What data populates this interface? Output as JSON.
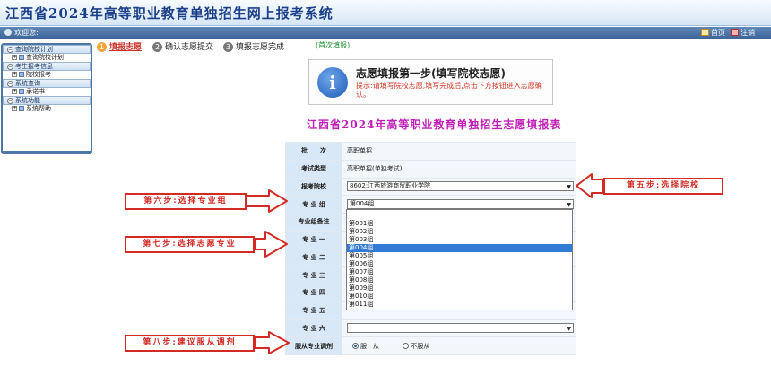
{
  "header": {
    "title": "江西省2024年高等职业教育单独招生网上报考系统"
  },
  "topbar": {
    "welcome": "欢迎您:",
    "home": "首页",
    "logout": "注销"
  },
  "sidebar": {
    "groups": [
      {
        "label": "查询院校计划",
        "items": [
          {
            "label": "查询院校计划"
          }
        ]
      },
      {
        "label": "考生报考信息",
        "items": [
          {
            "label": "院校报考"
          }
        ]
      },
      {
        "label": "系统查询",
        "items": [
          {
            "label": "承诺书"
          }
        ]
      },
      {
        "label": "系统功能",
        "items": [
          {
            "label": "系统帮助"
          }
        ]
      }
    ]
  },
  "steps": [
    {
      "num": "1",
      "label": "填报志愿"
    },
    {
      "num": "2",
      "label": "确认志愿提交"
    },
    {
      "num": "3",
      "label": "填报志愿完成"
    }
  ],
  "first_tag": "(首次填报)",
  "info": {
    "title": "志愿填报第一步(填写院校志愿)",
    "text": "提示:请填写院校志愿,填写完成后,点击下方按钮进入志愿确认。"
  },
  "form": {
    "title": "江西省2024年高等职业教育单独招生志愿填报表",
    "rows": {
      "batch": {
        "label": "批　　次",
        "value": "高职单招"
      },
      "exam_type": {
        "label": "考试类型",
        "value": "高职单招(单独考试)"
      },
      "school": {
        "label": "报考院校",
        "value": "8602:江西旅游商贸职业学院"
      },
      "group": {
        "label": "专 业 组",
        "value": "第004组"
      },
      "group_note": {
        "label": "专业组备注"
      },
      "major1": {
        "label": "专 业 一"
      },
      "major2": {
        "label": "专 业 二"
      },
      "major3": {
        "label": "专 业 三"
      },
      "major4": {
        "label": "专 业 四"
      },
      "major5": {
        "label": "专 业 五"
      },
      "major6": {
        "label": "专 业 六",
        "value": ""
      },
      "obey": {
        "label": "服从专业调剂",
        "yes": "服　从",
        "no": "不服从"
      }
    }
  },
  "dropdown": {
    "options": [
      "第001组",
      "第002组",
      "第003组",
      "第004组",
      "第005组",
      "第006组",
      "第007组",
      "第008组",
      "第009组",
      "第010组",
      "第011组"
    ],
    "selected_index": 3
  },
  "annotations": {
    "step5": "第五步:选择院校",
    "step6": "第六步:选择专业组",
    "step7": "第七步:选择志愿专业",
    "step8": "第八步:建议服从调剂"
  },
  "colors": {
    "annotation": "#d32a24",
    "highlight": "#3379d6",
    "form_title": "#c01fb7"
  }
}
